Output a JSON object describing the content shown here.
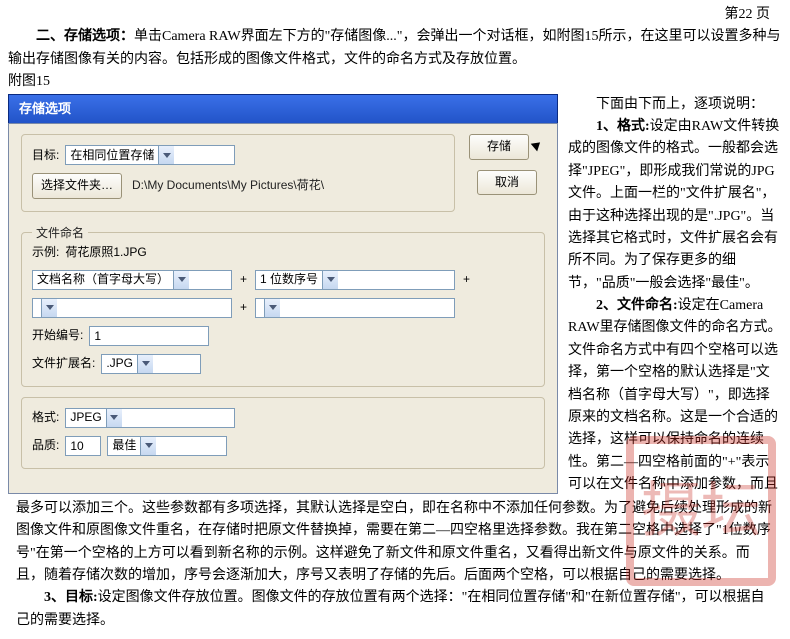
{
  "page_number": "第22 页",
  "intro_bold": "二、存储选项：",
  "intro_rest": "单击Camera RAW界面左下方的\"存储图像...\"，会弹出一个对话框，如附图15所示，在这里可以设置多种与输出存储图像有关的内容。包括形成的图像文件格式，文件的命名方式及存放位置。",
  "figref": "附图15",
  "dialog": {
    "title": "存储选项",
    "buttons": {
      "save": "存储",
      "cancel": "取消"
    },
    "target": {
      "label": "目标:",
      "location_value": "在相同位置存储",
      "select_folder": "选择文件夹…",
      "path": "D:\\My Documents\\My Pictures\\荷花\\"
    },
    "naming": {
      "legend": "文件命名",
      "example_label": "示例:",
      "example_value": "荷花原照1.JPG",
      "slot1": "文档名称（首字母大写）",
      "slot2": "1 位数序号",
      "slot3": "",
      "slot4": "",
      "start_label": "开始编号:",
      "start_value": "1",
      "ext_label": "文件扩展名:",
      "ext_value": ".JPG"
    },
    "format": {
      "label": "格式:",
      "value": "JPEG",
      "quality_label": "品质:",
      "quality_num": "10",
      "quality_text": "最佳"
    }
  },
  "right": {
    "lead": "下面由下而上，逐项说明：",
    "p1_bold": "1、格式:",
    "p1_rest": "设定由RAW文件转换成的图像文件的格式。一般都会选择\"JPEG\"，即形成我们常说的JPG文件。上面一栏的\"文件扩展名\"，由于这种选择出现的是\".JPG\"。当选择其它格式时，文件扩展名会有所不同。为了保存更多的细节，\"品质\"一般会选择\"最佳\"。",
    "p2_bold": "2、文件命名:",
    "p2_rest": "设定在Camera RAW里存储图像文件的命名方式。文件命名方式中有四个空格可以选择，第一个空格的默认选择是\"文档名称（首字母大写）\"，即选择原来的文档名称。这是一个合适的选择，这样可以保持命名的连续性。第二—四空格前面的\"+\"表示可以在文件名称中添加参数，而且"
  },
  "cont": "最多可以添加三个。这些参数都有多项选择，其默认选择是空白，即在名称中不添加任何参数。为了避免后续处理形成的新图像文件和原图像文件重名，在存储时把原文件替换掉，需要在第二—四空格里选择参数。我在第二空格中选择了\"1位数序号\"在第一个空格的上方可以看到新名称的示例。这样避免了新文件和原文件重名，又看得出新文件与原文件的关系。而且，随着存储次数的增加，序号会逐渐加大，序号又表明了存储的先后。后面两个空格，可以根据自己的需要选择。",
  "p3_bold": "3、目标:",
  "p3_rest": "设定图像文件存放位置。图像文件的存放位置有两个选择：\"在相同位置存储\"和\"在新位置存储\"，可以根据自己的需要选择。",
  "stamp": "摄坛"
}
